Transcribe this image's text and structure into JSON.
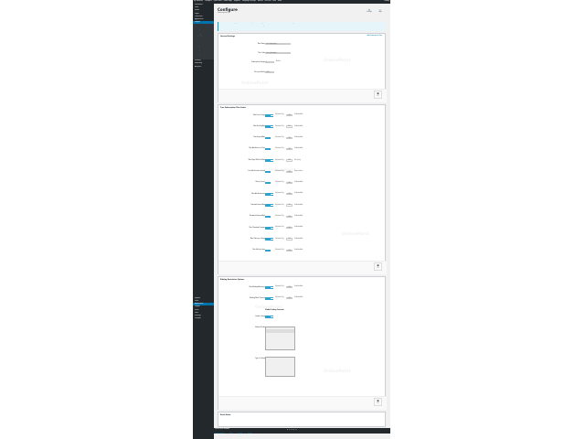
{
  "admin_bar": {
    "items": [
      "My Websites",
      "Configure",
      "Quick Start",
      "Home Page",
      "Supports",
      "Language Settings",
      "Notices",
      "Kilo Plus",
      "New",
      "Posts"
    ],
    "right": "Howdy"
  },
  "sidebar": {
    "items": [
      "Dashboard",
      "Posts",
      "Media",
      "Pages",
      "Comments",
      "Appearance",
      "Plugins",
      "Users",
      "Tools",
      "Settings",
      "Products",
      "Ordering",
      "Shopping",
      "Customers",
      "Options",
      "General",
      "Design",
      "Connections",
      "Listings",
      "Stats",
      "Settings",
      "Profile",
      "Security",
      "Marketing",
      "Analytics",
      "Reports",
      "Plans",
      "Appearance",
      "Plugins",
      "Users",
      "Tools",
      "Settings",
      "Collapse"
    ]
  },
  "page": {
    "title": "Configure",
    "subtitle": "Subscription Plan",
    "action_1": "Settings",
    "action_2": "Help"
  },
  "notice": {
    "line1": "The amounts in this page are in minutes. Here you can configure the amount for each of the default listing values.",
    "line2": "To restore the default values use the Reset button below. Changes are saved when Save is clicked."
  },
  "panels": {
    "general": {
      "title": "General Settings",
      "link": "Add Subscription Plan",
      "rows": [
        {
          "label": "Plan Name",
          "value": "Free Subscription",
          "desc": "Enter the name of the subscription plan as shown to members."
        },
        {
          "label": "Plan Code",
          "value": "free_subscription",
          "desc": "Unique code used to identify this plan."
        },
        {
          "label": "Subscription Length",
          "value": "1",
          "unit": "Months",
          "desc": "How long the subscription lasts before renewing."
        },
        {
          "label": "Price per Month",
          "value": "0.00",
          "desc": "The price charged each month for this plan."
        }
      ]
    },
    "listing": {
      "title": "Free Subscription Plan Limits",
      "rows": [
        {
          "label": "Max Free Listings",
          "mid": "100",
          "tail": "Total Available"
        },
        {
          "label": "Max Pending Ads",
          "mid": "100",
          "tail": "Total Available"
        },
        {
          "label": "Max Expired Ads",
          "mid": "100",
          "tail": "Total Available"
        },
        {
          "label": "Max Ads Active at Time",
          "mid": "100",
          "tail": "Total Available"
        },
        {
          "label": "Max Days With Pro Mark",
          "mid": "100",
          "tail": "Per Listing"
        },
        {
          "label": "Free Ad Duration Setting",
          "mid": "100",
          "tail": "Days Duration"
        },
        {
          "label": "Max In Queue",
          "mid": "100",
          "tail": "Total Available"
        },
        {
          "label": "Max Ads Reactivate",
          "mid": "100",
          "tail": "Total Available"
        },
        {
          "label": "Standard Search Ads",
          "mid": "100",
          "tail": "Total Available"
        },
        {
          "label": "Standard Featured Ads",
          "mid": "100",
          "tail": "Total Available"
        },
        {
          "label": "Max Thumbnail Images",
          "mid": "100",
          "tail": "Total Available"
        },
        {
          "label": "Max Video per Listing",
          "mid": "100",
          "tail": "Total Available"
        },
        {
          "label": "Max Gallery Items",
          "mid": "100",
          "tail": "Total Available"
        }
      ]
    },
    "bidding": {
      "title": "Bidding Restriction Options",
      "rows": [
        {
          "label": "Max Bidding Allowance",
          "mid": "100",
          "tail": "Total Available"
        },
        {
          "label": "Bidding Block Timeout",
          "mid": "100",
          "tail": "Total Available"
        }
      ],
      "group_heading": "Global Listing Controls",
      "enable_label": "Enable Listing",
      "field_label": "Allowed Fields",
      "field_options": [
        "Title",
        "Listing Description",
        "Location",
        "Image"
      ],
      "type_label": "Type of Listing",
      "type_options": [
        "Standard Ad",
        "Featured Ad",
        "Premium Ad",
        "Urgent Ad",
        "Top Listing Ad",
        "Homepage Ad",
        "Spotlight Ad",
        "Gallery Ad",
        "Bump Up Ad"
      ]
    },
    "last": {
      "title": "Event Items",
      "desc": "Event items is a collection of events for the selected plan."
    }
  },
  "option_text": "Unlimited Only",
  "save_label": "Save",
  "watermark_text": "OnlinePoint",
  "footer": {
    "brand": "Online Point Software",
    "links": [
      "Documentation",
      "Help",
      "Support",
      "Version"
    ],
    "dots": "● ● ● ● ●"
  },
  "colors": {
    "accent": "#0073aa",
    "toggle": "#2ea2cc",
    "admin_bar": "#23282d",
    "notice_bg": "#e5f5fa"
  }
}
